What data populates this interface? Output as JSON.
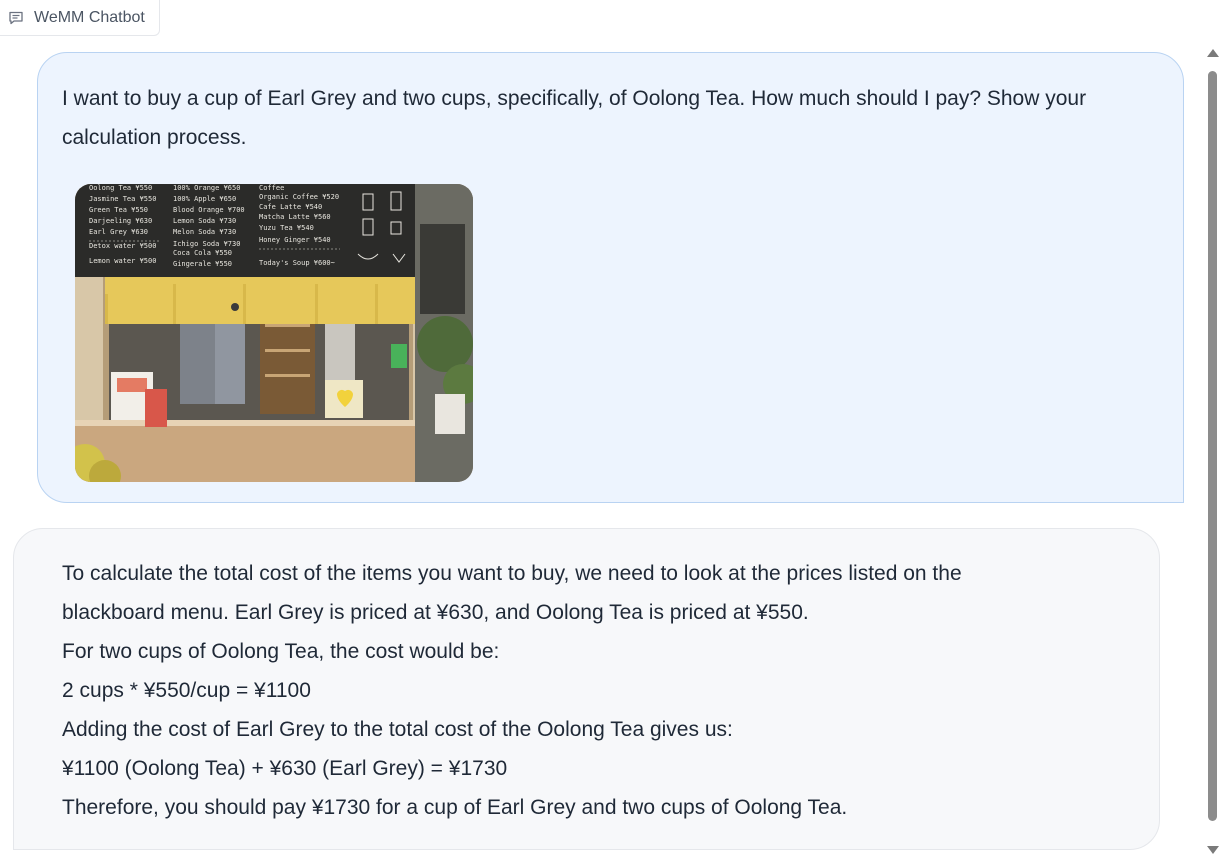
{
  "app": {
    "tab_label": "WeMM Chatbot",
    "tab_icon": "chat-bubble-icon"
  },
  "conversation": {
    "user_message": {
      "text": "I want to buy a cup of Earl Grey and two cups, specifically, of Oolong Tea. How much should I pay? Show your calculation process.",
      "image": {
        "description_icon": "photo-image",
        "menu_board": {
          "col1": [
            {
              "item": "Oolong Tea",
              "price": "¥550"
            },
            {
              "item": "Jasmine Tea",
              "price": "¥550"
            },
            {
              "item": "Green Tea",
              "price": "¥550"
            },
            {
              "item": "Darjeeling",
              "price": "¥630"
            },
            {
              "item": "Earl Grey",
              "price": "¥630"
            },
            {
              "item": "Detox water",
              "price": "¥500"
            },
            {
              "item": "Lemon water",
              "price": "¥500"
            }
          ],
          "col2": [
            {
              "item": "100% Orange",
              "price": "¥650"
            },
            {
              "item": "100% Apple",
              "price": "¥650"
            },
            {
              "item": "Blood Orange",
              "price": "¥700"
            },
            {
              "item": "Lemon Soda",
              "price": "¥730"
            },
            {
              "item": "Melon Soda",
              "price": "¥730"
            },
            {
              "item": "Ichigo Soda",
              "price": "¥730"
            },
            {
              "item": "Coca Cola",
              "price": "¥550"
            },
            {
              "item": "Gingerale",
              "price": "¥550"
            }
          ],
          "col3": [
            {
              "item": "Coffee",
              "price": ""
            },
            {
              "item": "Organic Coffee",
              "price": "¥520"
            },
            {
              "item": "Cafe Latte",
              "price": "¥540"
            },
            {
              "item": "Matcha Latte",
              "price": "¥560"
            },
            {
              "item": "Yuzu Tea",
              "price": "¥540"
            },
            {
              "item": "Honey Ginger",
              "price": "¥540"
            },
            {
              "item": "Today's Soup",
              "price": "¥600~"
            }
          ]
        }
      }
    },
    "bot_message": {
      "lines": [
        "To calculate the total cost of the items you want to buy, we need to look at the prices listed on the",
        "blackboard menu. Earl Grey is priced at ¥630, and Oolong Tea is priced at ¥550.",
        "For two cups of Oolong Tea, the cost would be:",
        "2 cups * ¥550/cup = ¥1100",
        "Adding the cost of Earl Grey to the total cost of the Oolong Tea gives us:",
        "¥1100 (Oolong Tea) + ¥630 (Earl Grey) = ¥1730",
        "Therefore, you should pay ¥1730 for a cup of Earl Grey and two cups of Oolong Tea."
      ]
    }
  },
  "colors": {
    "user_bubble_bg": "#edf4fe",
    "user_bubble_border": "#b9d3f2",
    "bot_bubble_bg": "#f7f8fa",
    "text": "#1f2937"
  }
}
